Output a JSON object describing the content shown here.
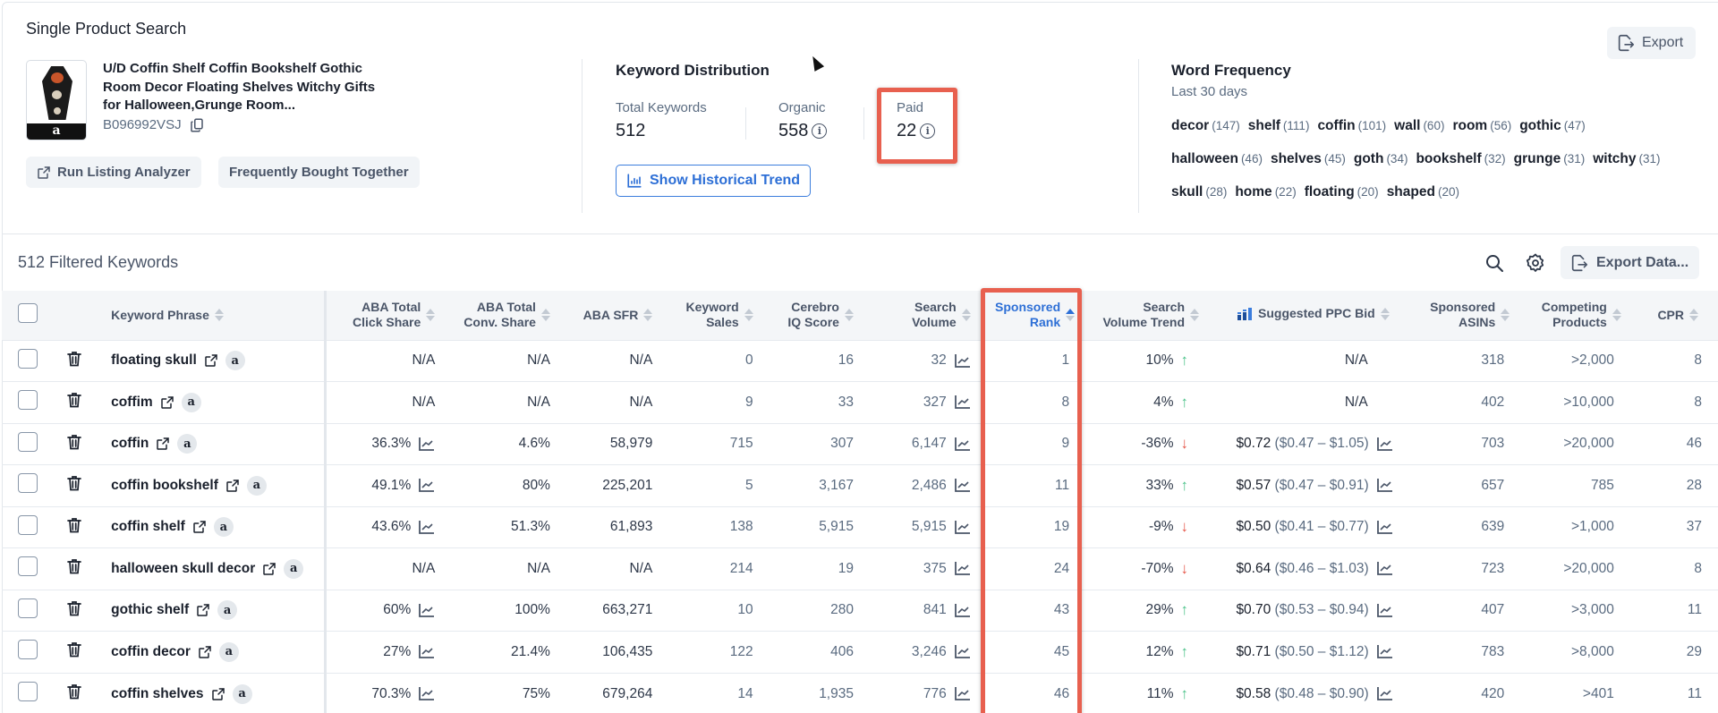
{
  "header": {
    "title": "Single Product Search",
    "export_label": "Export"
  },
  "product": {
    "title": "U/D Coffin Shelf Coffin Bookshelf Gothic Room Decor Floating Shelves Witchy Gifts for Halloween,Grunge Room...",
    "asin": "B096992VSJ",
    "thumb_badge": "a",
    "run_listing_label": "Run Listing Analyzer",
    "fbt_label": "Frequently Bought Together"
  },
  "keyword_distribution": {
    "title": "Keyword Distribution",
    "total_label": "Total Keywords",
    "total_value": "512",
    "organic_label": "Organic",
    "organic_value": "558",
    "paid_label": "Paid",
    "paid_value": "22",
    "info_glyph": "i",
    "historical_button": "Show Historical Trend"
  },
  "word_frequency": {
    "title": "Word Frequency",
    "subtitle": "Last 30 days",
    "words": [
      {
        "word": "decor",
        "count": "(147)"
      },
      {
        "word": "shelf",
        "count": "(111)"
      },
      {
        "word": "coffin",
        "count": "(101)"
      },
      {
        "word": "wall",
        "count": "(60)"
      },
      {
        "word": "room",
        "count": "(56)"
      },
      {
        "word": "gothic",
        "count": "(47)"
      },
      {
        "word": "halloween",
        "count": "(46)"
      },
      {
        "word": "shelves",
        "count": "(45)"
      },
      {
        "word": "goth",
        "count": "(34)"
      },
      {
        "word": "bookshelf",
        "count": "(32)"
      },
      {
        "word": "grunge",
        "count": "(31)"
      },
      {
        "word": "witchy",
        "count": "(31)"
      },
      {
        "word": "skull",
        "count": "(28)"
      },
      {
        "word": "home",
        "count": "(22)"
      },
      {
        "word": "floating",
        "count": "(20)"
      },
      {
        "word": "shaped",
        "count": "(20)"
      }
    ]
  },
  "toolbar": {
    "filtered_label": "512 Filtered Keywords",
    "export_data_label": "Export Data..."
  },
  "table": {
    "headers": {
      "keyword": "Keyword Phrase",
      "click_share": [
        "ABA Total",
        "Click Share"
      ],
      "conv_share": [
        "ABA Total",
        "Conv. Share"
      ],
      "sfr": "ABA SFR",
      "kw_sales": [
        "Keyword",
        "Sales"
      ],
      "iq": [
        "Cerebro",
        "IQ Score"
      ],
      "volume": [
        "Search",
        "Volume"
      ],
      "sp_rank": [
        "Sponsored",
        "Rank"
      ],
      "trend": [
        "Search",
        "Volume Trend"
      ],
      "ppc": "Suggested PPC Bid",
      "sp_asins": [
        "Sponsored",
        "ASINs"
      ],
      "competing": [
        "Competing",
        "Products"
      ],
      "cpr": "CPR"
    },
    "sorted_column": "Sponsored Rank",
    "sort_direction": "ascending",
    "amazon_badge": "a",
    "rows": [
      {
        "keyword": "floating skull",
        "click_share": "N/A",
        "click_chart": false,
        "conv_share": "N/A",
        "sfr": "N/A",
        "kw_sales": "0",
        "iq": "16",
        "volume": "32",
        "sp_rank": "1",
        "trend": "10%",
        "trend_dir": "up",
        "ppc": "N/A",
        "ppc_range": "",
        "sp_asins": "318",
        "competing": ">2,000",
        "cpr": "8"
      },
      {
        "keyword": "coffim",
        "click_share": "N/A",
        "click_chart": false,
        "conv_share": "N/A",
        "sfr": "N/A",
        "kw_sales": "9",
        "iq": "33",
        "volume": "327",
        "sp_rank": "8",
        "trend": "4%",
        "trend_dir": "up",
        "ppc": "N/A",
        "ppc_range": "",
        "sp_asins": "402",
        "competing": ">10,000",
        "cpr": "8"
      },
      {
        "keyword": "coffin",
        "click_share": "36.3%",
        "click_chart": true,
        "conv_share": "4.6%",
        "sfr": "58,979",
        "kw_sales": "715",
        "iq": "307",
        "volume": "6,147",
        "sp_rank": "9",
        "trend": "-36%",
        "trend_dir": "down",
        "ppc": "$0.72",
        "ppc_range": "($0.47 – $1.05)",
        "sp_asins": "703",
        "competing": ">20,000",
        "cpr": "46"
      },
      {
        "keyword": "coffin bookshelf",
        "click_share": "49.1%",
        "click_chart": true,
        "conv_share": "80%",
        "sfr": "225,201",
        "kw_sales": "5",
        "iq": "3,167",
        "volume": "2,486",
        "sp_rank": "11",
        "trend": "33%",
        "trend_dir": "up",
        "ppc": "$0.57",
        "ppc_range": "($0.47 – $0.91)",
        "sp_asins": "657",
        "competing": "785",
        "cpr": "28"
      },
      {
        "keyword": "coffin shelf",
        "click_share": "43.6%",
        "click_chart": true,
        "conv_share": "51.3%",
        "sfr": "61,893",
        "kw_sales": "138",
        "iq": "5,915",
        "volume": "5,915",
        "sp_rank": "19",
        "trend": "-9%",
        "trend_dir": "down",
        "ppc": "$0.50",
        "ppc_range": "($0.41 – $0.77)",
        "sp_asins": "639",
        "competing": ">1,000",
        "cpr": "37"
      },
      {
        "keyword": "halloween skull decor",
        "click_share": "N/A",
        "click_chart": false,
        "conv_share": "N/A",
        "sfr": "N/A",
        "kw_sales": "214",
        "iq": "19",
        "volume": "375",
        "sp_rank": "24",
        "trend": "-70%",
        "trend_dir": "down",
        "ppc": "$0.64",
        "ppc_range": "($0.46 – $1.03)",
        "sp_asins": "723",
        "competing": ">20,000",
        "cpr": "8"
      },
      {
        "keyword": "gothic shelf",
        "click_share": "60%",
        "click_chart": true,
        "conv_share": "100%",
        "sfr": "663,271",
        "kw_sales": "10",
        "iq": "280",
        "volume": "841",
        "sp_rank": "43",
        "trend": "29%",
        "trend_dir": "up",
        "ppc": "$0.70",
        "ppc_range": "($0.53 – $0.94)",
        "sp_asins": "407",
        "competing": ">3,000",
        "cpr": "11"
      },
      {
        "keyword": "coffin decor",
        "click_share": "27%",
        "click_chart": true,
        "conv_share": "21.4%",
        "sfr": "106,435",
        "kw_sales": "122",
        "iq": "406",
        "volume": "3,246",
        "sp_rank": "45",
        "trend": "12%",
        "trend_dir": "up",
        "ppc": "$0.71",
        "ppc_range": "($0.50 – $1.12)",
        "sp_asins": "783",
        "competing": ">8,000",
        "cpr": "29"
      },
      {
        "keyword": "coffin shelves",
        "click_share": "70.3%",
        "click_chart": true,
        "conv_share": "75%",
        "sfr": "679,264",
        "kw_sales": "14",
        "iq": "1,935",
        "volume": "776",
        "sp_rank": "46",
        "trend": "11%",
        "trend_dir": "up",
        "ppc": "$0.58",
        "ppc_range": "($0.48 – $0.90)",
        "sp_asins": "420",
        "competing": ">401",
        "cpr": "11"
      }
    ]
  },
  "icons": {
    "trend_up": "↑",
    "trend_down": "↓"
  },
  "colors": {
    "accent": "#2d6fd6",
    "highlight": "#e8604f",
    "trend_up": "#4cc38a",
    "trend_down": "#e5574a"
  }
}
